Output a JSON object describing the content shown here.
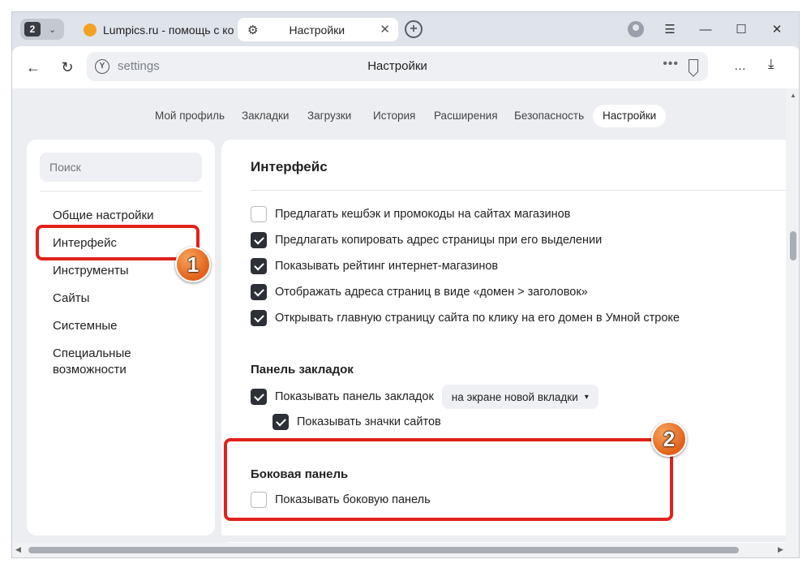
{
  "window": {
    "tab_count": "2",
    "tabs": [
      {
        "label": "Lumpics.ru - помощь с ко"
      },
      {
        "label": "Настройки"
      }
    ]
  },
  "address_bar": {
    "url": "settings",
    "page_title": "Настройки"
  },
  "section_tabs": [
    "Мой профиль",
    "Закладки",
    "Загрузки",
    "История",
    "Расширения",
    "Безопасность",
    "Настройки"
  ],
  "sidebar": {
    "search_placeholder": "Поиск",
    "items": [
      {
        "label": "Общие настройки"
      },
      {
        "label": "Интерфейс"
      },
      {
        "label": "Инструменты"
      },
      {
        "label": "Сайты"
      },
      {
        "label": "Системные"
      },
      {
        "label": "Специальные возможности"
      }
    ]
  },
  "main": {
    "title": "Интерфейс",
    "options": [
      {
        "label": "Предлагать кешбэк и промокоды на сайтах магазинов",
        "checked": false
      },
      {
        "label": "Предлагать копировать адрес страницы при его выделении",
        "checked": true
      },
      {
        "label": "Показывать рейтинг интернет-магазинов",
        "checked": true
      },
      {
        "label": "Отображать адреса страниц в виде «домен > заголовок»",
        "checked": true
      },
      {
        "label": "Открывать главную страницу сайта по клику на его домен в Умной строке",
        "checked": true
      }
    ],
    "bookmarks_panel": {
      "title": "Панель закладок",
      "show_label": "Показывать панель закладок",
      "show_checked": true,
      "dropdown_value": "на экране новой вкладки",
      "icons_label": "Показывать значки сайтов",
      "icons_checked": true
    },
    "side_panel": {
      "title": "Боковая панель",
      "show_label": "Показывать боковую панель",
      "show_checked": false
    }
  },
  "annotations": {
    "badge1": "1",
    "badge2": "2",
    "highlight_color": "#e0221b"
  }
}
